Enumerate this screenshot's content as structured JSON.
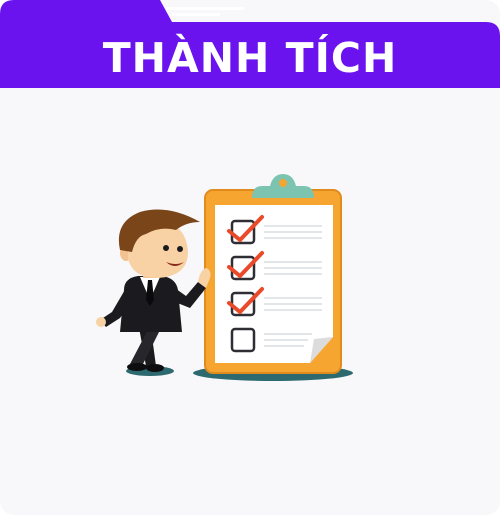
{
  "header": {
    "title": "THÀNH TÍCH"
  },
  "colors": {
    "header_purple": "#6a13ee",
    "card_background": "#f8f8fa",
    "clipboard_orange": "#f6a531",
    "clip_teal": "#7cc4b0",
    "check_red": "#ea4a2a",
    "suit_black": "#1b1b1f",
    "hair_brown": "#7a4519",
    "skin": "#f8d2a4"
  },
  "illustration": {
    "checklist": {
      "items": [
        {
          "checked": true
        },
        {
          "checked": true
        },
        {
          "checked": true
        },
        {
          "checked": false
        }
      ]
    }
  }
}
